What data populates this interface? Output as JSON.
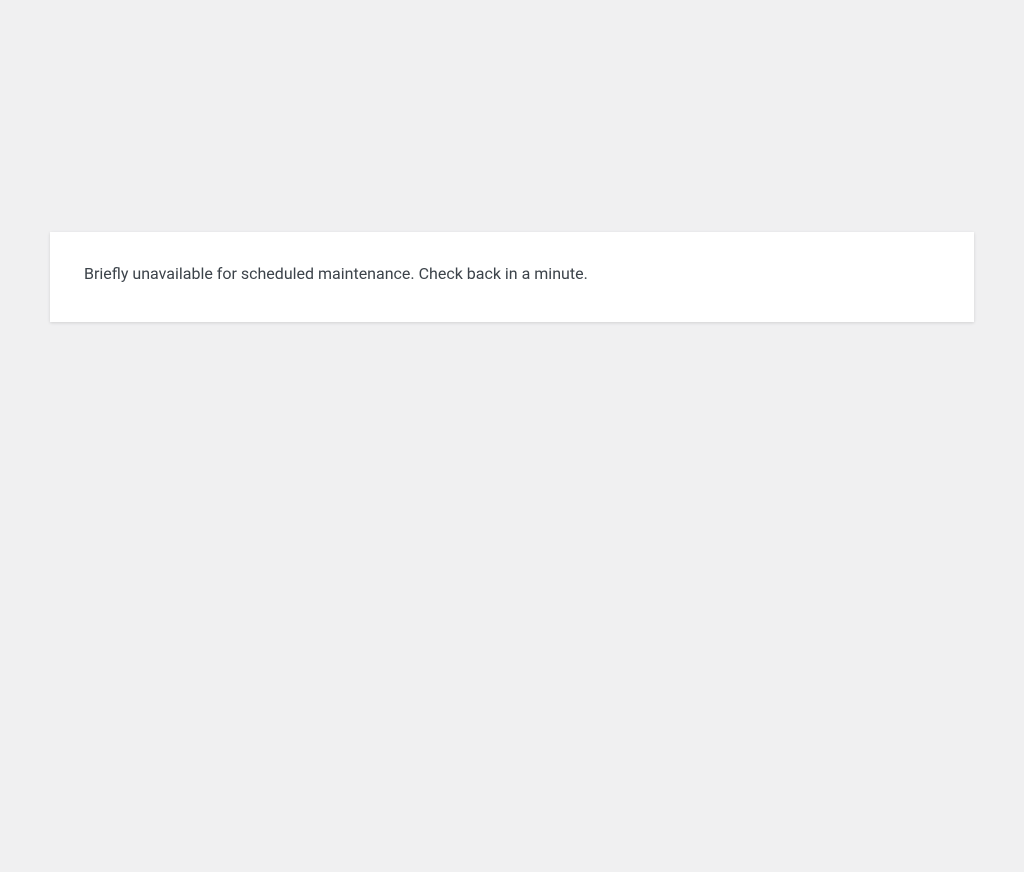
{
  "maintenance": {
    "message": "Briefly unavailable for scheduled maintenance. Check back in a minute."
  }
}
